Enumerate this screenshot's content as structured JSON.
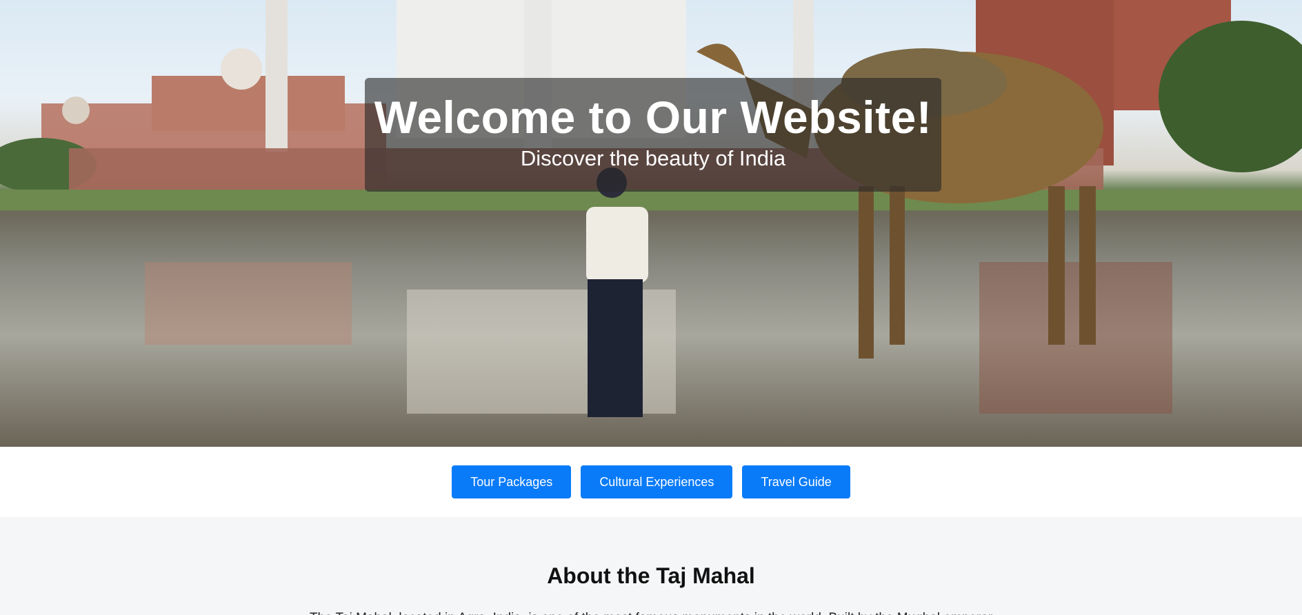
{
  "hero": {
    "title": "Welcome to Our Website!",
    "subtitle": "Discover the beauty of India"
  },
  "nav": {
    "buttons": [
      {
        "label": "Tour Packages"
      },
      {
        "label": "Cultural Experiences"
      },
      {
        "label": "Travel Guide"
      }
    ]
  },
  "about": {
    "heading": "About the Taj Mahal",
    "paragraph": "The Taj Mahal, located in Agra, India, is one of the most famous monuments in the world. Built by the Mughal emperor"
  },
  "colors": {
    "button_bg": "#0a7bf8",
    "overlay_bg": "rgba(40,40,40,0.62)",
    "about_bg": "#f4f6f8"
  }
}
